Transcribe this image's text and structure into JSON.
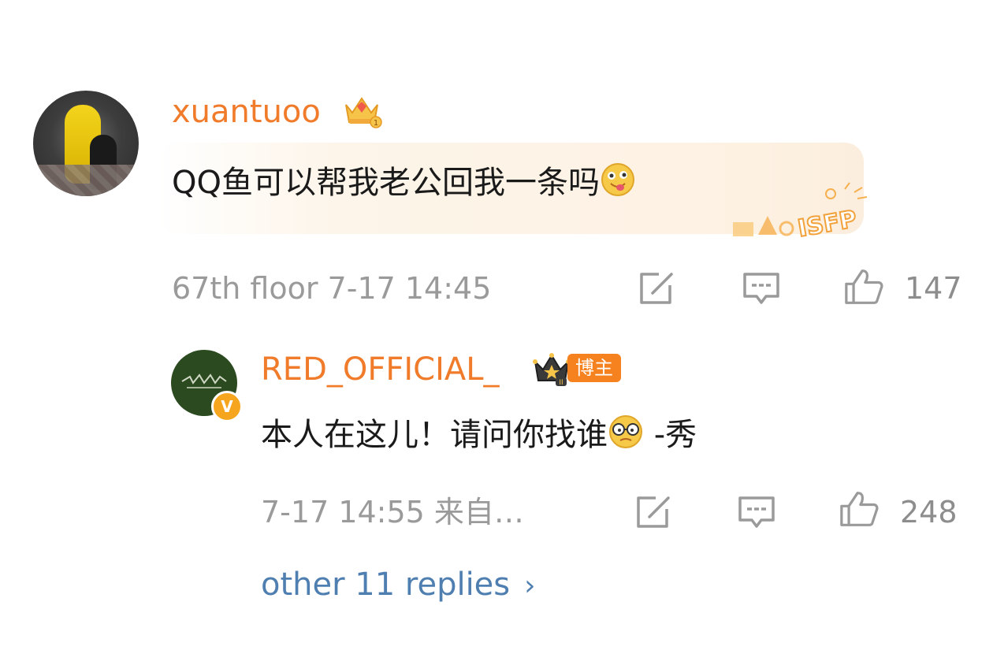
{
  "main_comment": {
    "username": "xuantuoo",
    "text": "QQ鱼可以帮我老公回我一条吗",
    "emoji_icon": "tongue-face-emoji",
    "decoration_text": "ISFP",
    "meta": "67th floor 7-17 14:45",
    "likes": "147",
    "badge_icon": "crown-level-1-icon"
  },
  "reply": {
    "username": "RED_OFFICIAL_",
    "verified_mark": "V",
    "role_badge": "博主",
    "text": "本人在这儿！请问你找谁",
    "emoji_icon": "glasses-face-emoji",
    "signature": " -秀",
    "meta": "7-17 14:55 来自…",
    "likes": "248",
    "badge_icon": "king-crown-level-2-icon"
  },
  "more_replies": {
    "label": "other 11 replies",
    "chevron": "›"
  },
  "colors": {
    "username": "#f07b2b",
    "link": "#4f7fb0",
    "meta": "#9a9a9a",
    "text": "#1a1a1a"
  }
}
